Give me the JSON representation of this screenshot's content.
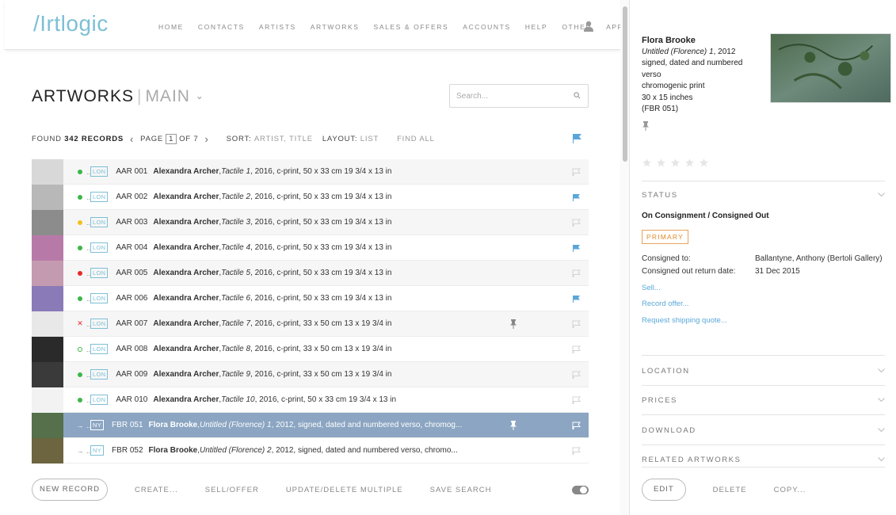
{
  "app": {
    "logo": "/Irtlogic",
    "nav": [
      "HOME",
      "CONTACTS",
      "ARTISTS",
      "ARTWORKS",
      "SALES & OFFERS",
      "ACCOUNTS",
      "HELP",
      "OTHER",
      "APP"
    ],
    "accent": "#7dbfd6"
  },
  "page": {
    "title": "ARTWORKS",
    "separator": "|",
    "subtitle": "MAIN",
    "caret": "⌄",
    "search_placeholder": "Search..."
  },
  "info": {
    "found_label": "FOUND",
    "count": "342 RECORDS",
    "page_label": "PAGE",
    "page": "1",
    "of_label": "OF 7",
    "sort_label": "SORT:",
    "sort_value": "ARTIST, TITLE",
    "layout_label": "LAYOUT:",
    "layout_value": "LIST",
    "find_all": "FIND ALL",
    "prev": "‹",
    "next": "›"
  },
  "rows": [
    {
      "status": "green",
      "loc": "LON",
      "code": "AAR 001",
      "artist": "Alexandra Archer",
      "title": "Tactile 1",
      "rest": ", 2016, c-print, 50 x 33 cm 19 3/4 x 13 in",
      "flag": "empty",
      "pin": false,
      "thumb": "#d8d8d8"
    },
    {
      "status": "green",
      "loc": "LON",
      "code": "AAR 002",
      "artist": "Alexandra Archer",
      "title": "Tactile 2",
      "rest": ", 2016, c-print, 50 x 33 cm 19 3/4 x 13 in",
      "flag": "blue",
      "pin": false,
      "thumb": "#b8b8b8"
    },
    {
      "status": "yellow",
      "loc": "LON",
      "code": "AAR 003",
      "artist": "Alexandra Archer",
      "title": "Tactile 3",
      "rest": ", 2016, c-print, 50 x 33 cm 19 3/4 x 13 in",
      "flag": "empty",
      "pin": false,
      "thumb": "#8c8c8c"
    },
    {
      "status": "green",
      "loc": "LON",
      "code": "AAR 004",
      "artist": "Alexandra Archer",
      "title": "Tactile 4",
      "rest": ", 2016, c-print, 50 x 33 cm 19 3/4 x 13 in",
      "flag": "blue",
      "pin": false,
      "thumb": "#b77aa8"
    },
    {
      "status": "red",
      "loc": "LON",
      "code": "AAR 005",
      "artist": "Alexandra Archer",
      "title": "Tactile 5",
      "rest": ", 2016, c-print, 50 x 33 cm 19 3/4 x 13 in",
      "flag": "empty",
      "pin": false,
      "thumb": "#c49ab0"
    },
    {
      "status": "green",
      "loc": "LON",
      "code": "AAR 006",
      "artist": "Alexandra Archer",
      "title": "Tactile 6",
      "rest": ", 2016, c-print, 50 x 33 cm 19 3/4 x 13 in",
      "flag": "blue",
      "pin": false,
      "thumb": "#8a7ab8"
    },
    {
      "status": "cross",
      "loc": "LON",
      "code": "AAR 007",
      "artist": "Alexandra Archer",
      "title": "Tactile 7",
      "rest": ", 2016, c-print, 33 x 50 cm 13 x 19 3/4 in",
      "flag": "empty",
      "pin": true,
      "thumb": "#e8e8e8"
    },
    {
      "status": "ring",
      "loc": "LON",
      "code": "AAR 008",
      "artist": "Alexandra Archer",
      "title": "Tactile 8",
      "rest": ", 2016, c-print, 33 x 50 cm 13 x 19 3/4 in",
      "flag": "empty",
      "pin": false,
      "thumb": "#2a2a2a"
    },
    {
      "status": "green",
      "loc": "LON",
      "code": "AAR 009",
      "artist": "Alexandra Archer",
      "title": "Tactile 9",
      "rest": ", 2016, c-print, 33 x 50 cm 13 x 19 3/4 in",
      "flag": "empty",
      "pin": false,
      "thumb": "#3a3a3a"
    },
    {
      "status": "green",
      "loc": "LON",
      "code": "AAR 010",
      "artist": "Alexandra Archer",
      "title": "Tactile 10",
      "rest": ", 2016, c-print, 50 x 33 cm 19 3/4 x 13 in",
      "flag": "empty",
      "pin": false,
      "thumb": "#f2f2f2"
    },
    {
      "status": "arrow",
      "loc": "NY",
      "code": "FBR 051",
      "artist": "Flora Brooke",
      "title": "Untitled (Florence) 1",
      "rest": ", 2012, signed, dated and numbered verso, chromog...",
      "flag": "white",
      "pin": true,
      "thumb": "#55704a",
      "selected": true
    },
    {
      "status": "arrow",
      "loc": "NY",
      "code": "FBR 052",
      "artist": "Flora Brooke",
      "title": "Untitled (Florence) 2",
      "rest": ", 2012, signed, dated and numbered verso, chromo...",
      "flag": "empty",
      "pin": false,
      "thumb": "#6d6440"
    }
  ],
  "actions": {
    "new_record": "NEW RECORD",
    "create": "CREATE...",
    "sell_offer": "SELL/OFFER",
    "update_delete": "UPDATE/DELETE MULTIPLE",
    "save_search": "SAVE SEARCH"
  },
  "detail": {
    "artist": "Flora Brooke",
    "title": "Untitled (Florence) 1",
    "year": ", 2012",
    "line1": "signed, dated and numbered",
    "line2": "verso",
    "medium": "chromogenic print",
    "size": "30 x 15 inches",
    "ref": "(FBR 051)",
    "status_section": "STATUS",
    "status_value": "On Consignment / Consigned Out",
    "primary": "PRIMARY",
    "consigned_to_label": "Consigned to:",
    "consigned_to_value": "Ballantyne, Anthony (Bertoli Gallery)",
    "return_label": "Consigned out return date:",
    "return_value": "31 Dec 2015",
    "link_sell": "Sell...",
    "link_offer": "Record offer...",
    "link_shipping": "Request shipping quote...",
    "sections": [
      "LOCATION",
      "PRICES",
      "DOWNLOAD",
      "RELATED ARTWORKS"
    ],
    "edit": "EDIT",
    "delete": "DELETE",
    "copy": "COPY...",
    "rating": 0,
    "max_rating": 5
  },
  "colors": {
    "green": "#3cb64a",
    "yellow": "#f2c21b",
    "red": "#e8282b",
    "flag_blue": "#5ba6d9",
    "selected_row": "#8ba5c2",
    "primary_orange": "#e08a2a",
    "link_blue": "#5aa8d8"
  }
}
